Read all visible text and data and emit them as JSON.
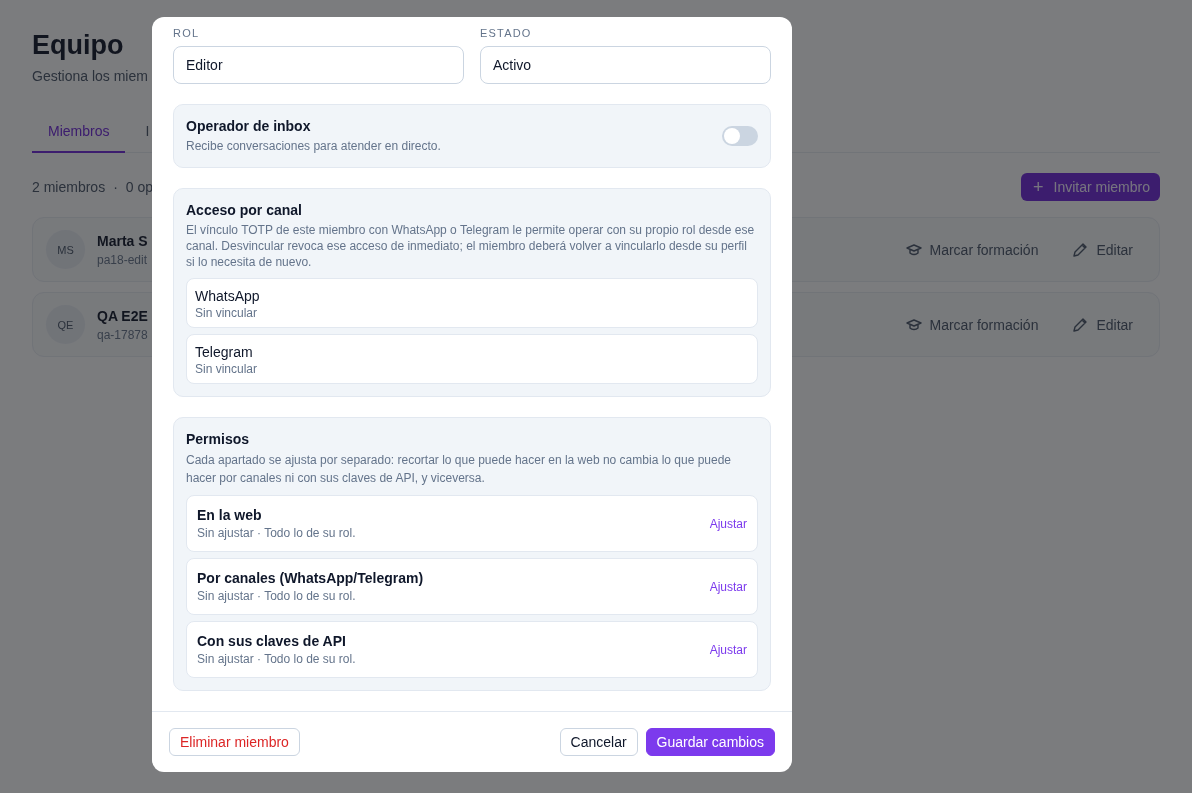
{
  "page": {
    "title": "Equipo",
    "subtitle": "Gestiona los miem",
    "tabs": [
      {
        "label": "Miembros",
        "selected": true
      },
      {
        "label": "I",
        "selected": false
      }
    ],
    "summary": [
      "2 miembros",
      "·",
      "0 op"
    ],
    "invite_button": {
      "icon": "+",
      "label": "Invitar miembro"
    },
    "members": [
      {
        "initials": "MS",
        "name": "Marta S",
        "detail": "pa18-edit",
        "actions": [
          {
            "kind": "training",
            "label": "Marcar formación"
          },
          {
            "kind": "edit",
            "label": "Editar"
          }
        ]
      },
      {
        "initials": "QE",
        "name": "QA E2E",
        "detail": "qa-17878",
        "actions": [
          {
            "kind": "training",
            "label": "Marcar formación"
          },
          {
            "kind": "edit",
            "label": "Editar"
          }
        ]
      }
    ]
  },
  "modal": {
    "fields": [
      {
        "label": "ROL",
        "value": "Editor"
      },
      {
        "label": "ESTADO",
        "value": "Activo"
      }
    ],
    "inbox_operator": {
      "title": "Operador de inbox",
      "description": "Recibe conversaciones para atender en directo.",
      "on": false
    },
    "channel_access": {
      "title": "Acceso por canal",
      "description": "El vínculo TOTP de este miembro con WhatsApp o Telegram le permite operar con su propio rol desde ese canal. Desvincular revoca ese acceso de inmediato; el miembro deberá volver a vincularlo desde su perfil si lo necesita de nuevo.",
      "channels": [
        {
          "name": "WhatsApp",
          "status": "Sin vincular"
        },
        {
          "name": "Telegram",
          "status": "Sin vincular"
        }
      ]
    },
    "permissions": {
      "title": "Permisos",
      "description": "Cada apartado se ajusta por separado: recortar lo que puede hacer en la web no cambia lo que puede hacer por canales ni con sus claves de API, y viceversa.",
      "items": [
        {
          "title": "En la web",
          "status": "Sin ajustar · Todo lo de su rol.",
          "action": "Ajustar"
        },
        {
          "title": "Por canales (WhatsApp/Telegram)",
          "status": "Sin ajustar · Todo lo de su rol.",
          "action": "Ajustar"
        },
        {
          "title": "Con sus claves de API",
          "status": "Sin ajustar · Todo lo de su rol.",
          "action": "Ajustar"
        }
      ]
    },
    "footer": {
      "delete_button": "Eliminar miembro",
      "cancel_button": "Cancelar",
      "save_button": "Guardar cambios"
    }
  }
}
